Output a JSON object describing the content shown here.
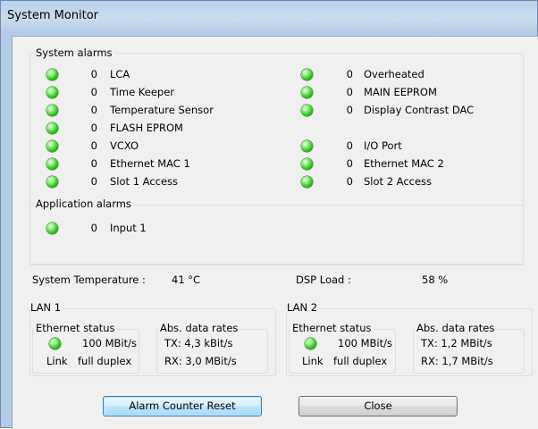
{
  "window": {
    "title": "System Monitor"
  },
  "system_alarms": {
    "legend": "System alarms",
    "left": [
      {
        "count": "0",
        "label": "LCA",
        "led": true
      },
      {
        "count": "0",
        "label": "Time Keeper",
        "led": true
      },
      {
        "count": "0",
        "label": "Temperature Sensor",
        "led": true
      },
      {
        "count": "0",
        "label": "FLASH EPROM",
        "led": true
      },
      {
        "count": "0",
        "label": "VCXO",
        "led": true
      },
      {
        "count": "0",
        "label": "Ethernet MAC 1",
        "led": true
      },
      {
        "count": "0",
        "label": "Slot 1 Access",
        "led": true
      }
    ],
    "right": [
      {
        "count": "0",
        "label": "Overheated",
        "led": true
      },
      {
        "count": "0",
        "label": "MAIN EEPROM",
        "led": true
      },
      {
        "count": "0",
        "label": "Display Contrast DAC",
        "led": true
      },
      {
        "count": "0",
        "label": "I/O Port",
        "led": true
      },
      {
        "count": "0",
        "label": "Ethernet MAC 2",
        "led": true
      },
      {
        "count": "0",
        "label": "Slot 2 Access",
        "led": true
      }
    ]
  },
  "application_alarms": {
    "legend": "Application alarms",
    "items": [
      {
        "count": "0",
        "label": "Input 1",
        "led": true
      }
    ]
  },
  "status": {
    "temperature_label": "System Temperature :",
    "temperature_value": "41 °C",
    "dsp_label": "DSP Load :",
    "dsp_value": "58 %"
  },
  "lan1": {
    "legend": "LAN 1",
    "ethernet_status_legend": "Ethernet status",
    "speed": "100 MBit/s",
    "link_label": "Link",
    "duplex": "full duplex",
    "rates_legend": "Abs. data rates",
    "tx": "TX: 4,3 kBit/s",
    "rx": "RX: 3,0 MBit/s"
  },
  "lan2": {
    "legend": "LAN 2",
    "ethernet_status_legend": "Ethernet status",
    "speed": "100 MBit/s",
    "link_label": "Link",
    "duplex": "full duplex",
    "rates_legend": "Abs. data rates",
    "tx": "TX: 1,2 MBit/s",
    "rx": "RX: 1,7 MBit/s"
  },
  "buttons": {
    "alarm_reset": "Alarm Counter Reset",
    "close": "Close"
  },
  "colors": {
    "led_ok": "#2fc21c",
    "dialog_background": "#f0f0f0",
    "title_bar": "#b9d1ea"
  }
}
